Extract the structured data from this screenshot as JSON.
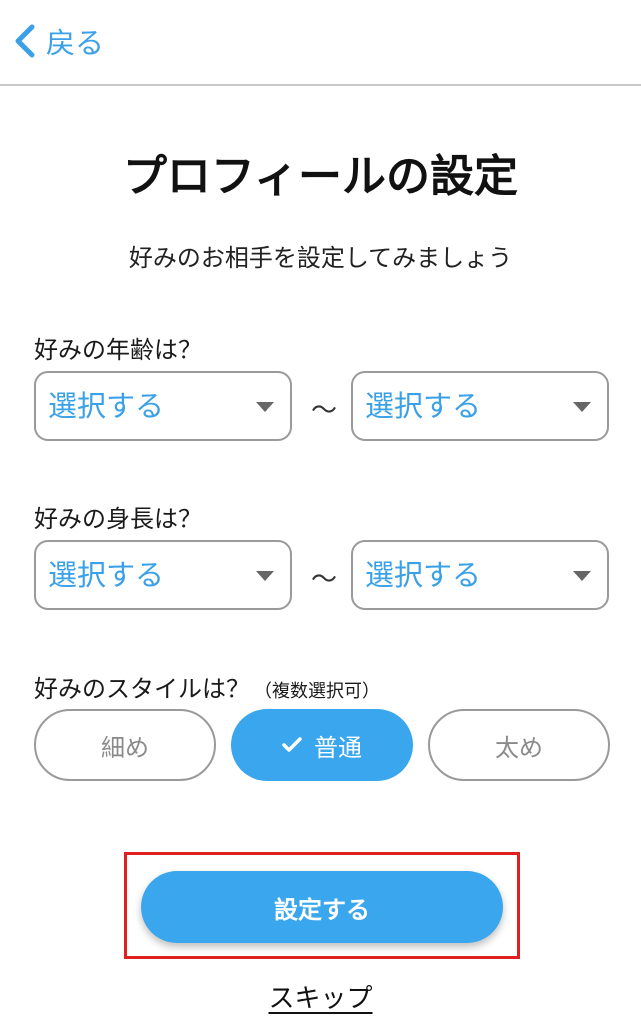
{
  "header": {
    "back_label": "戻る",
    "back_icon": "chevron-left-icon",
    "accent_color": "#3aa0e8"
  },
  "title": "プロフィールの設定",
  "subtitle": "好みのお相手を設定してみましょう",
  "age": {
    "label": "好みの年齢は？",
    "from": "選択する",
    "to": "選択する",
    "separator": "〜"
  },
  "height": {
    "label": "好みの身長は？",
    "from": "選択する",
    "to": "選択する",
    "separator": "〜"
  },
  "style": {
    "label": "好みのスタイルは？",
    "note": "（複数選択可）",
    "options": [
      {
        "label": "細め",
        "selected": false
      },
      {
        "label": "普通",
        "selected": true
      },
      {
        "label": "太め",
        "selected": false
      }
    ]
  },
  "submit_label": "設定する",
  "skip_label": "スキップ",
  "colors": {
    "primary": "#3aa6ee",
    "highlight_border": "#e02020"
  }
}
